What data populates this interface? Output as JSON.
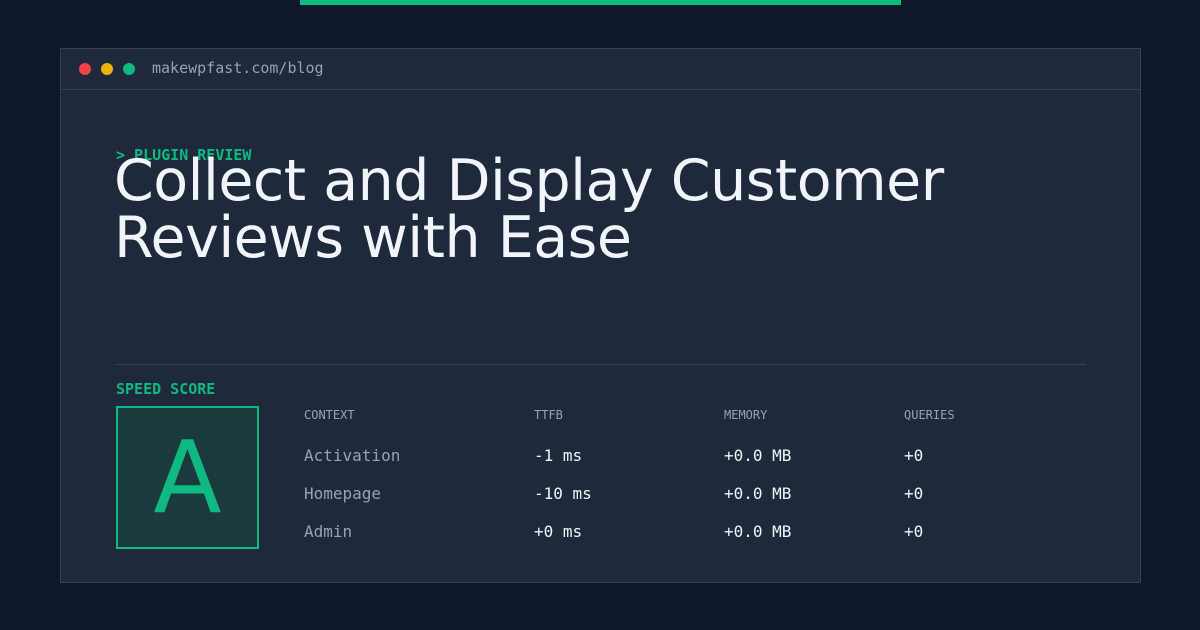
{
  "colors": {
    "background": "#0f172a",
    "card": "#1e293b",
    "border": "#334155",
    "accent": "#10b981",
    "text": "#f1f5f9",
    "muted": "#94a3b8",
    "dot_red": "#ef4444",
    "dot_yellow": "#eab308",
    "dot_green": "#10b981"
  },
  "window": {
    "url": "makewpfast.com/blog",
    "dots": [
      "close-dot",
      "minimize-dot",
      "maximize-dot"
    ]
  },
  "post": {
    "eyebrow": "> PLUGIN REVIEW",
    "title": "Collect and Display Customer Reviews with Ease"
  },
  "speed": {
    "label": "SPEED SCORE",
    "grade": "A"
  },
  "metrics": {
    "headers": {
      "context": "CONTEXT",
      "ttfb": "TTFB",
      "memory": "MEMORY",
      "queries": "QUERIES"
    },
    "rows": [
      {
        "context": "Activation",
        "ttfb": "-1 ms",
        "memory": "+0.0 MB",
        "queries": "+0"
      },
      {
        "context": "Homepage",
        "ttfb": "-10 ms",
        "memory": "+0.0 MB",
        "queries": "+0"
      },
      {
        "context": "Admin",
        "ttfb": "+0 ms",
        "memory": "+0.0 MB",
        "queries": "+0"
      }
    ]
  }
}
